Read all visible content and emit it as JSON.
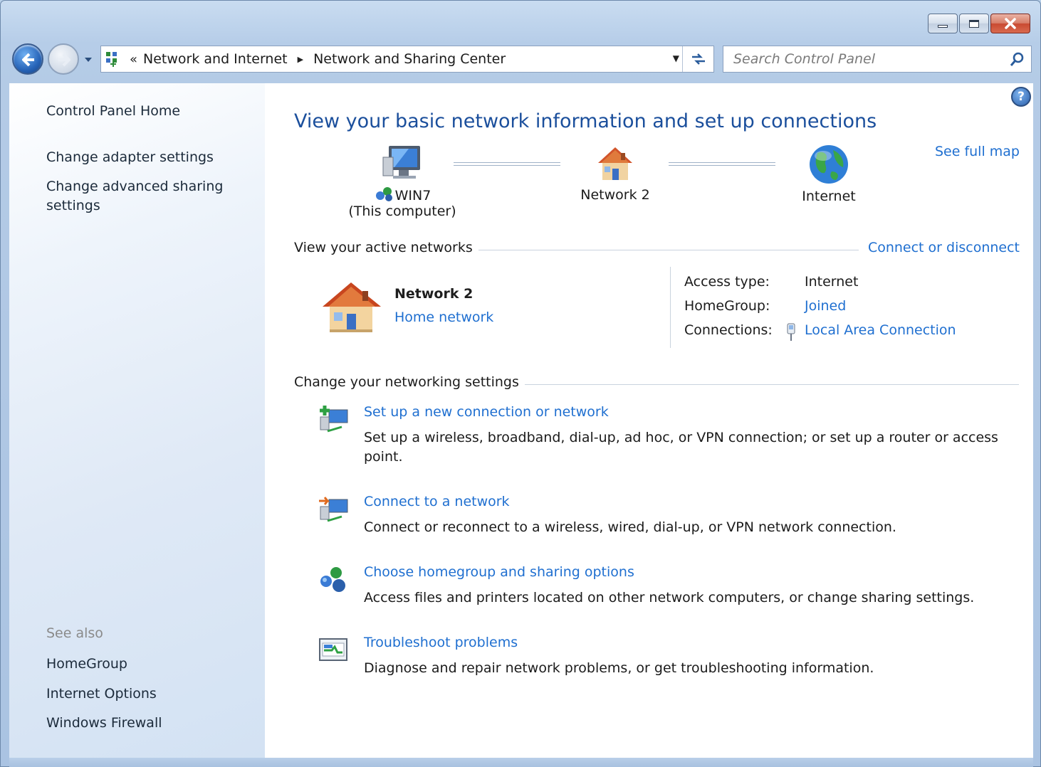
{
  "window": {
    "caption_buttons": [
      "minimize",
      "maximize",
      "close"
    ]
  },
  "address_bar": {
    "overflow": "«",
    "crumbs": [
      "Network and Internet",
      "Network and Sharing Center"
    ]
  },
  "search": {
    "placeholder": "Search Control Panel"
  },
  "sidebar": {
    "home": "Control Panel Home",
    "links": [
      "Change adapter settings",
      "Change advanced sharing settings"
    ],
    "see_also_title": "See also",
    "see_also": [
      "HomeGroup",
      "Internet Options",
      "Windows Firewall"
    ]
  },
  "main": {
    "title": "View your basic network information and set up connections",
    "see_full_map": "See full map",
    "map": {
      "computer_name": "WIN7",
      "computer_sub": "(This computer)",
      "network": "Network  2",
      "internet": "Internet"
    },
    "active": {
      "heading": "View your active networks",
      "connect_link": "Connect or disconnect",
      "network_name": "Network  2",
      "network_type": "Home network",
      "access_type_label": "Access type:",
      "access_type_value": "Internet",
      "homegroup_label": "HomeGroup:",
      "homegroup_value": "Joined",
      "connections_label": "Connections:",
      "connections_value": "Local Area Connection"
    },
    "settings": {
      "heading": "Change your networking settings",
      "tasks": [
        {
          "title": "Set up a new connection or network",
          "desc": "Set up a wireless, broadband, dial-up, ad hoc, or VPN connection; or set up a router or access point.",
          "icon": "new-connection-icon"
        },
        {
          "title": "Connect to a network",
          "desc": "Connect or reconnect to a wireless, wired, dial-up, or VPN network connection.",
          "icon": "connect-network-icon"
        },
        {
          "title": "Choose homegroup and sharing options",
          "desc": "Access files and printers located on other network computers, or change sharing settings.",
          "icon": "homegroup-icon"
        },
        {
          "title": "Troubleshoot problems",
          "desc": "Diagnose and repair network problems, or get troubleshooting information.",
          "icon": "troubleshoot-icon"
        }
      ]
    }
  },
  "colors": {
    "link": "#1f6fd0",
    "title": "#1b4f9c",
    "sidebar_text": "#1b2a3a"
  }
}
